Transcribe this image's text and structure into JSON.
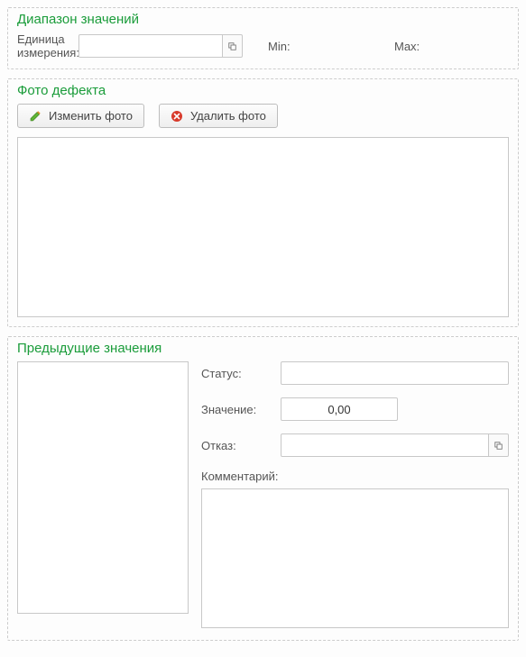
{
  "range": {
    "legend": "Диапазон значений",
    "unit_label": "Единица\nизмерения:",
    "unit_value": "",
    "min_label": "Min:",
    "max_label": "Max:"
  },
  "photo": {
    "legend": "Фото дефекта",
    "change_label": "Изменить фото",
    "delete_label": "Удалить фото"
  },
  "previous": {
    "legend": "Предыдущие значения",
    "status_label": "Статус:",
    "status_value": "",
    "value_label": "Значение:",
    "value_value": "0,00",
    "refusal_label": "Отказ:",
    "refusal_value": "",
    "comment_label": "Комментарий:",
    "comment_value": ""
  }
}
